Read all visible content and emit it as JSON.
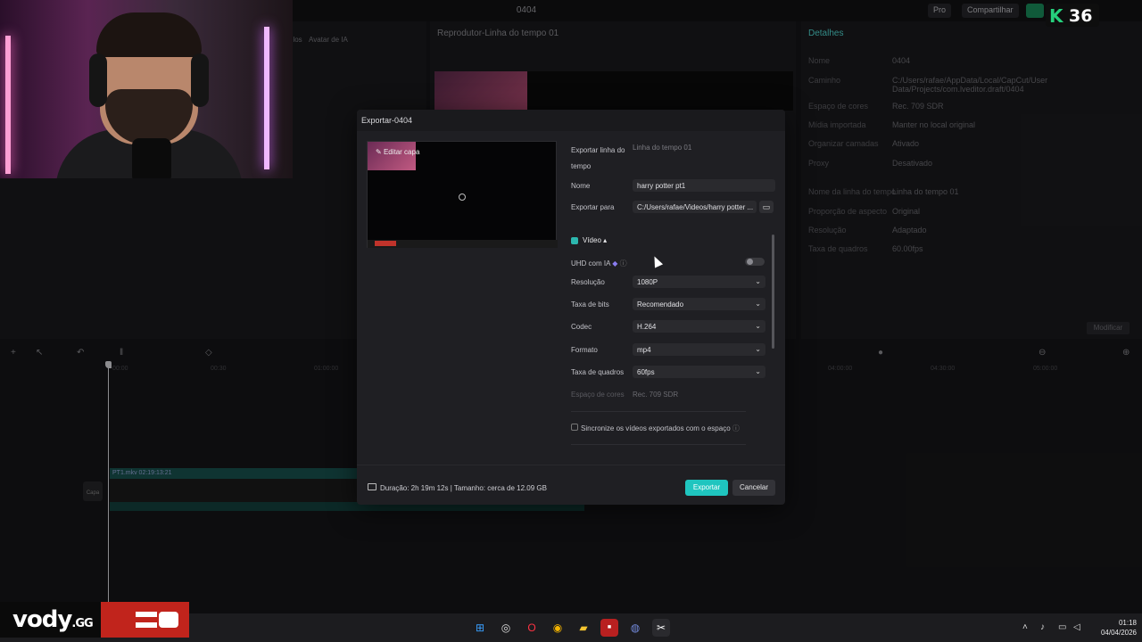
{
  "window": {
    "title": "0404"
  },
  "topbar": {
    "pro_label": "Pro",
    "share_label": "Compartilhar"
  },
  "stream_badge": {
    "letter": "K",
    "count": "36"
  },
  "left_panel": {
    "tab_models": "elos",
    "tab_avatar": "Avatar de IA"
  },
  "player": {
    "title": "Reprodutor-Linha do tempo 01"
  },
  "details": {
    "title": "Detalhes",
    "rows": [
      {
        "label": "Nome",
        "value": "0404"
      },
      {
        "label": "Caminho",
        "value": "C:/Users/rafae/AppData/Local/CapCut/User Data/Projects/com.lveditor.draft/0404"
      },
      {
        "label": "Espaço de cores",
        "value": "Rec. 709 SDR"
      },
      {
        "label": "Mídia importada",
        "value": "Manter no local original"
      },
      {
        "label": "Organizar camadas",
        "value": "Ativado"
      },
      {
        "label": "Proxy",
        "value": "Desativado"
      },
      {
        "label": "Nome da linha do tempo",
        "value": "Linha do tempo 01"
      },
      {
        "label": "Proporção de aspecto",
        "value": "Original"
      },
      {
        "label": "Resolução",
        "value": "Adaptado"
      },
      {
        "label": "Taxa de quadros",
        "value": "60.00fps"
      }
    ],
    "modify_label": "Modificar"
  },
  "export_dialog": {
    "title": "Exportar-0404",
    "edit_cover_label": "Editar capa",
    "export_timeline_label": "Exportar linha do tempo",
    "export_timeline_value": "Linha do tempo 01",
    "name_label": "Nome",
    "name_value": "harry potter pt1",
    "export_to_label": "Exportar para",
    "export_to_value": "C:/Users/rafae/Videos/harry potter ...",
    "video_section_label": "Vídeo",
    "uhd_label": "UHD com IA",
    "resolution_label": "Resolução",
    "resolution_value": "1080P",
    "bitrate_label": "Taxa de bits",
    "bitrate_value": "Recomendado",
    "codec_label": "Codec",
    "codec_value": "H.264",
    "format_label": "Formato",
    "format_value": "mp4",
    "framerate_label": "Taxa de quadros",
    "framerate_value": "60fps",
    "colorspace_label": "Espaço de cores",
    "colorspace_value": "Rec. 709 SDR",
    "sync_label": "Sincronize os vídeos exportados com o espaço",
    "duration_text": "Duração: 2h 19m 12s | Tamanho: cerca de 12.09 GB",
    "export_button": "Exportar",
    "cancel_button": "Cancelar"
  },
  "timeline": {
    "ruler": [
      "00:00",
      "00:30",
      "01:00:00",
      "04:00:00",
      "04:30:00",
      "05:00:00"
    ],
    "clip_label": "PT1.mkv  02:19:13:21",
    "cover_label": "Capa"
  },
  "branding": {
    "name": "vody",
    "suffix": ".GG"
  },
  "taskbar": {
    "time": "01:18",
    "date": "04/04/2026"
  },
  "colors": {
    "accent": "#1fc5bf",
    "details_title": "#4fd6cf"
  }
}
